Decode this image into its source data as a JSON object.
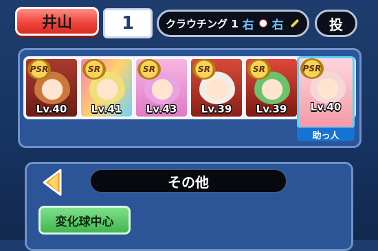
{
  "header": {
    "player_name": "井山",
    "batting_order": "1",
    "position_label": "クラウチング 1",
    "throws": "右",
    "bats": "右",
    "pitch_label": "投"
  },
  "characters": [
    {
      "rarity": "PSR",
      "level": "Lv.40",
      "hair_color": "#c9793a"
    },
    {
      "rarity": "SR",
      "level": "Lv.41",
      "hair_color": "#f0e07a"
    },
    {
      "rarity": "SR",
      "level": "Lv.43",
      "hair_color": "#e9a3e0"
    },
    {
      "rarity": "SR",
      "level": "Lv.39",
      "hair_color": "#f1eee6"
    },
    {
      "rarity": "SR",
      "level": "Lv.39",
      "hair_color": "#6bc36b"
    },
    {
      "rarity": "PSR",
      "level": "Lv.40",
      "hair_color": "#f4d7d6",
      "tag": "助っ人"
    }
  ],
  "category": {
    "label": "その他"
  },
  "filters": [
    {
      "label": "変化球中心"
    }
  ],
  "colors": {
    "accent_red": "#f0453c",
    "panel_blue": "#2c5597",
    "filter_green": "#42b54f",
    "helper_blue": "#1473d4"
  }
}
